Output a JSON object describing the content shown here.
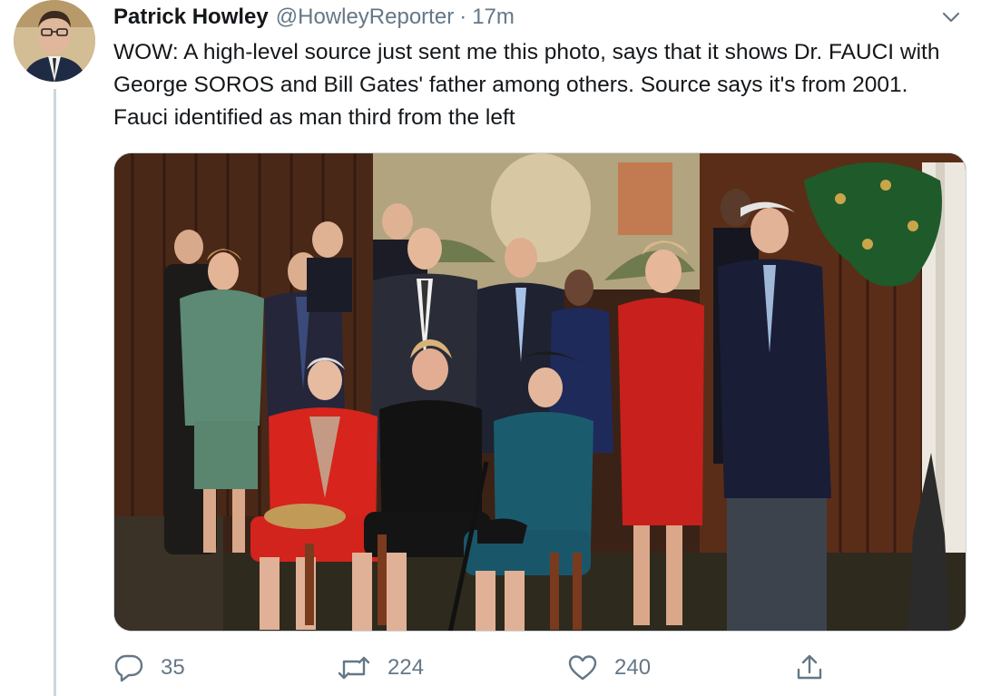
{
  "tweet": {
    "author": {
      "display_name": "Patrick Howley",
      "handle": "@HowleyReporter",
      "separator": "·",
      "time": "17m"
    },
    "text": "WOW: A high-level source just sent me this photo, says that it shows Dr. FAUCI with George SOROS and Bill Gates' father among others. Source says it's from 2001. Fauci identified as man third from the left",
    "media_description_icon": "photo",
    "actions": {
      "reply": {
        "icon": "reply-icon",
        "count": "35"
      },
      "retweet": {
        "icon": "retweet-icon",
        "count": "224"
      },
      "like": {
        "icon": "heart-icon",
        "count": "240"
      },
      "share": {
        "icon": "share-icon"
      }
    }
  },
  "colors": {
    "text": "#14171a",
    "secondary": "#657786",
    "border": "#ccd6dd"
  }
}
